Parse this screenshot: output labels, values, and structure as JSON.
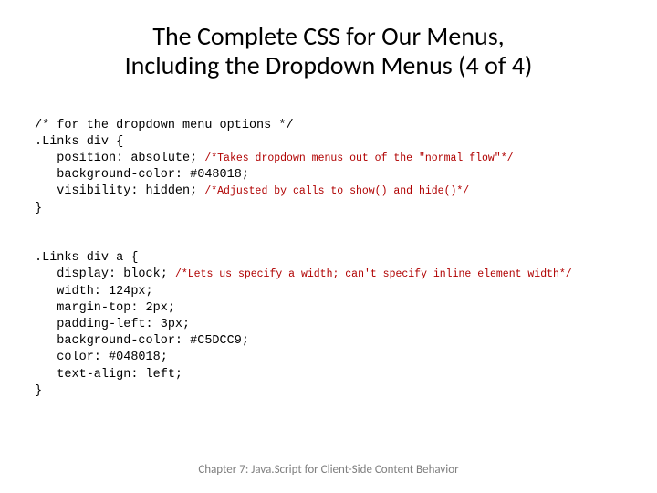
{
  "title_line1": "The Complete CSS for Our Menus,",
  "title_line2": "Including the Dropdown Menus (4 of 4)",
  "code": {
    "block1": {
      "l1": "/* for the dropdown menu options */",
      "l2": ".Links div {",
      "l3_pre": "   position: absolute; ",
      "l3_cmt": "/*Takes dropdown menus out of the \"normal flow\"*/",
      "l4": "   background-color: #048018;",
      "l5_pre": "   visibility: hidden; ",
      "l5_cmt": "/*Adjusted by calls to show() and hide()*/",
      "l6": "}"
    },
    "block2": {
      "l1": ".Links div a {",
      "l2_pre": "   display: block; ",
      "l2_cmt": "/*Lets us specify a width; can't specify inline element width*/",
      "l3": "   width: 124px;",
      "l4": "   margin-top: 2px;",
      "l5": "   padding-left: 3px;",
      "l6": "   background-color: #C5DCC9;",
      "l7": "   color: #048018;",
      "l8": "   text-align: left;",
      "l9": "}"
    }
  },
  "footer": "Chapter 7: Java.Script for Client-Side Content Behavior"
}
